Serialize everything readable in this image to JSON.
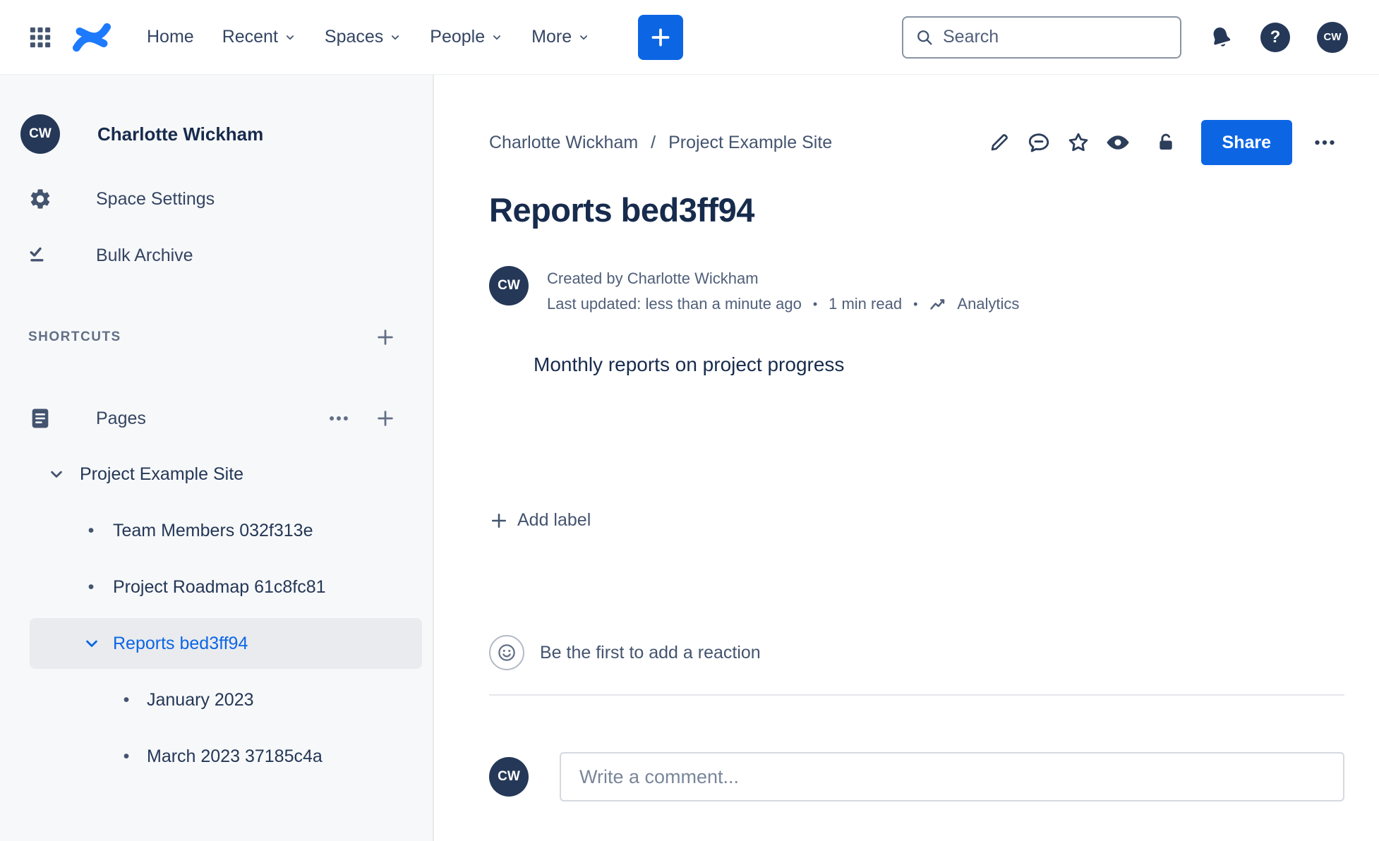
{
  "topnav": {
    "nav": [
      {
        "label": "Home",
        "has_dropdown": false
      },
      {
        "label": "Recent",
        "has_dropdown": true
      },
      {
        "label": "Spaces",
        "has_dropdown": true
      },
      {
        "label": "People",
        "has_dropdown": true
      },
      {
        "label": "More",
        "has_dropdown": true
      }
    ],
    "search_placeholder": "Search",
    "help_glyph": "?",
    "user_initials": "CW"
  },
  "sidebar": {
    "space_avatar_initials": "CW",
    "space_name": "Charlotte Wickham",
    "space_settings_label": "Space Settings",
    "bulk_archive_label": "Bulk Archive",
    "shortcuts_label": "SHORTCUTS",
    "pages_label": "Pages",
    "bullet_glyph": "•",
    "tree": {
      "root_label": "Project Example Site",
      "items": [
        {
          "label": "Team Members 032f313e",
          "selected": false
        },
        {
          "label": "Project Roadmap 61c8fc81",
          "selected": false
        },
        {
          "label": "Reports bed3ff94",
          "selected": true
        },
        {
          "label": "January 2023",
          "selected": false
        },
        {
          "label": "March 2023 37185c4a",
          "selected": false
        }
      ]
    }
  },
  "main": {
    "breadcrumb": {
      "crumb1": "Charlotte Wickham",
      "separator": "/",
      "crumb2": "Project Example Site"
    },
    "share_label": "Share",
    "page_title": "Reports bed3ff94",
    "byline": {
      "avatar_initials": "CW",
      "created_line": "Created by Charlotte Wickham",
      "updated_text": "Last updated: less than a minute ago",
      "separator": "•",
      "read_time": "1 min read",
      "analytics_label": "Analytics"
    },
    "body_text": "Monthly reports on project progress",
    "add_label_text": "Add label",
    "reaction_prompt": "Be the first to add a reaction",
    "comment": {
      "avatar_initials": "CW",
      "placeholder": "Write a comment..."
    }
  },
  "colors": {
    "brand_blue": "#0C66E4",
    "logo_blue": "#1D7AFC",
    "avatar_bg": "#253858",
    "text_dark": "#172B4D",
    "text_gray": "#44546F",
    "sidebar_bg": "#F7F8F9",
    "selected_item_bg": "#E9EBEF",
    "selected_item_text": "#0C66E4"
  }
}
